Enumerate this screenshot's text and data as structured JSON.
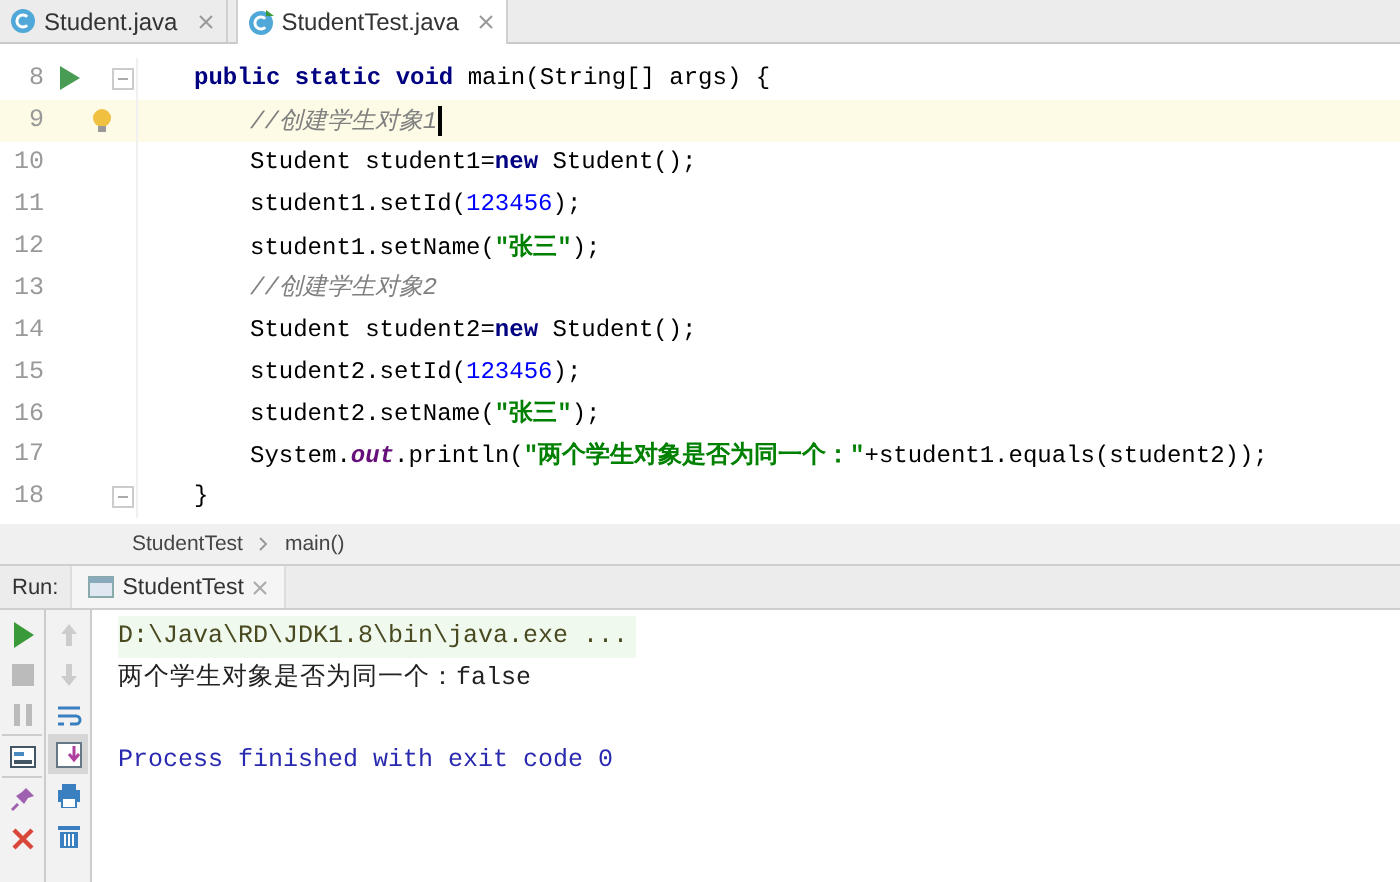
{
  "tabs": [
    {
      "label": "Student.java",
      "selected": false
    },
    {
      "label": "StudentTest.java",
      "selected": true
    }
  ],
  "editor": {
    "lines": [
      {
        "number": "8",
        "run": true,
        "fold": true,
        "highlight": false,
        "bulb": false,
        "tokens": [
          {
            "kind": "keyword",
            "text": "public static void "
          },
          {
            "kind": "plain",
            "text": "main(String[] args) {"
          }
        ],
        "children": [
          {
            "number": "9",
            "run": false,
            "fold": false,
            "highlight": true,
            "bulb": true,
            "tokens": [
              {
                "kind": "comment",
                "text": "//创建学生对象1"
              }
            ]
          },
          {
            "number": "10",
            "run": false,
            "fold": false,
            "highlight": false,
            "bulb": false,
            "tokens": [
              {
                "kind": "plain",
                "text": "Student student1="
              },
              {
                "kind": "keyword",
                "text": "new "
              },
              {
                "kind": "plain",
                "text": "Student();"
              }
            ]
          },
          {
            "number": "11",
            "run": false,
            "fold": false,
            "highlight": false,
            "bulb": false,
            "tokens": [
              {
                "kind": "plain",
                "text": "student1.setId("
              },
              {
                "kind": "number",
                "text": "123456"
              },
              {
                "kind": "plain",
                "text": ");"
              }
            ]
          },
          {
            "number": "12",
            "run": false,
            "fold": false,
            "highlight": false,
            "bulb": false,
            "tokens": [
              {
                "kind": "plain",
                "text": "student1.setName("
              },
              {
                "kind": "string",
                "text": "\"张三\""
              },
              {
                "kind": "plain",
                "text": ");"
              }
            ]
          },
          {
            "number": "13",
            "run": false,
            "fold": false,
            "highlight": false,
            "bulb": false,
            "tokens": [
              {
                "kind": "comment",
                "text": "//创建学生对象2"
              }
            ]
          },
          {
            "number": "14",
            "run": false,
            "fold": false,
            "highlight": false,
            "bulb": false,
            "tokens": [
              {
                "kind": "plain",
                "text": "Student student2="
              },
              {
                "kind": "keyword",
                "text": "new "
              },
              {
                "kind": "plain",
                "text": "Student();"
              }
            ]
          },
          {
            "number": "15",
            "run": false,
            "fold": false,
            "highlight": false,
            "bulb": false,
            "tokens": [
              {
                "kind": "plain",
                "text": "student2.setId("
              },
              {
                "kind": "number",
                "text": "123456"
              },
              {
                "kind": "plain",
                "text": ");"
              }
            ]
          },
          {
            "number": "16",
            "run": false,
            "fold": false,
            "highlight": false,
            "bulb": false,
            "tokens": [
              {
                "kind": "plain",
                "text": "student2.setName("
              },
              {
                "kind": "string",
                "text": "\"张三\""
              },
              {
                "kind": "plain",
                "text": ");"
              }
            ]
          },
          {
            "number": "17",
            "run": false,
            "fold": false,
            "highlight": false,
            "bulb": false,
            "tokens": [
              {
                "kind": "plain",
                "text": "System."
              },
              {
                "kind": "static",
                "text": "out"
              },
              {
                "kind": "plain",
                "text": ".println("
              },
              {
                "kind": "string",
                "text": "\"两个学生对象是否为同一个：\""
              },
              {
                "kind": "plain",
                "text": "+student1.equals(student2));"
              }
            ]
          }
        ]
      },
      {
        "number": "18",
        "run": false,
        "fold": true,
        "highlight": false,
        "bulb": false,
        "tokens": [
          {
            "kind": "plain",
            "text": "}"
          }
        ]
      }
    ]
  },
  "breadcrumb": [
    "StudentTest",
    "main()"
  ],
  "run_panel": {
    "label": "Run:",
    "tab": "StudentTest",
    "console": [
      {
        "kind": "command",
        "text": "D:\\Java\\RD\\JDK1.8\\bin\\java.exe ..."
      },
      {
        "kind": "output",
        "text": "两个学生对象是否为同一个：false"
      },
      {
        "kind": "exit",
        "text": "Process finished with exit code 0"
      }
    ]
  }
}
